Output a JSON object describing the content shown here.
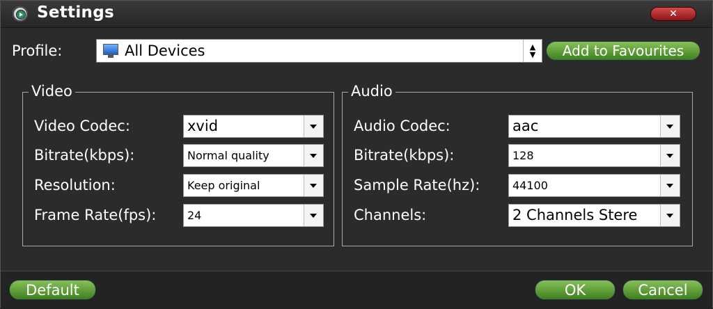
{
  "window": {
    "title": "Settings",
    "close_label": "✕"
  },
  "profile": {
    "label": "Profile:",
    "value": "All Devices",
    "icon": "device-monitor-icon",
    "add_favourites": "Add to Favourites"
  },
  "video": {
    "legend": "Video",
    "codec_label": "Video Codec:",
    "codec_value": "xvid",
    "bitrate_label": "Bitrate(kbps):",
    "bitrate_value": "Normal quality",
    "resolution_label": "Resolution:",
    "resolution_value": "Keep original",
    "framerate_label": "Frame Rate(fps):",
    "framerate_value": "24"
  },
  "audio": {
    "legend": "Audio",
    "codec_label": "Audio Codec:",
    "codec_value": "aac",
    "bitrate_label": "Bitrate(kbps):",
    "bitrate_value": "128",
    "samplerate_label": "Sample Rate(hz):",
    "samplerate_value": "44100",
    "channels_label": "Channels:",
    "channels_value": "2 Channels Stere"
  },
  "footer": {
    "default": "Default",
    "ok": "OK",
    "cancel": "Cancel"
  },
  "colors": {
    "accent_green": "#5a9a32",
    "close_red": "#b52a2a",
    "background": "#2b2b2b"
  }
}
